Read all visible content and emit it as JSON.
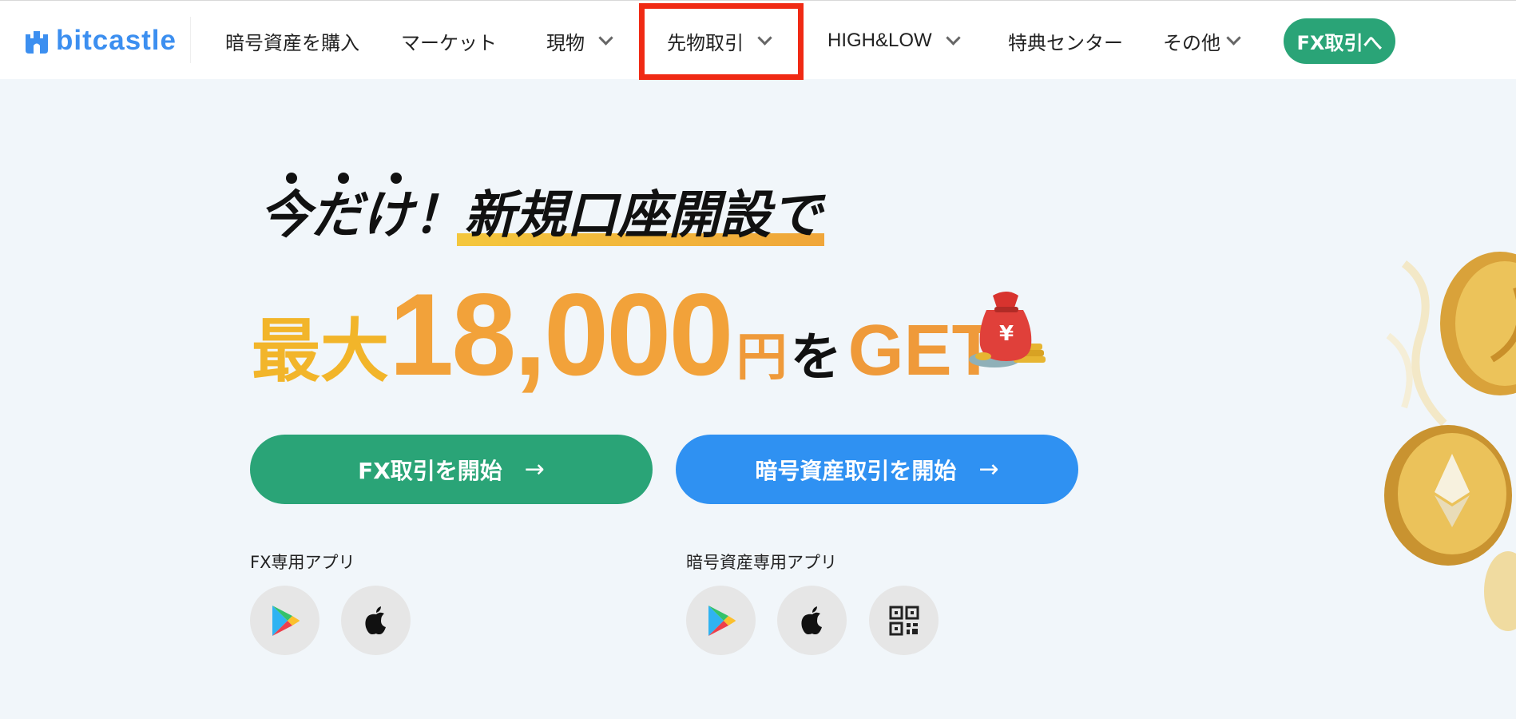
{
  "header": {
    "logo_text": "bitcastle",
    "nav": [
      {
        "label": "暗号資産を購入"
      },
      {
        "label": "マーケット"
      },
      {
        "label": "現物"
      },
      {
        "label": "先物取引"
      },
      {
        "label": "HIGH&LOW"
      },
      {
        "label": "特典センター"
      },
      {
        "label": "その他"
      }
    ],
    "cta_label": "FX取引へ"
  },
  "hero": {
    "line1_prefix": "今だけ！",
    "line1_highlight": "新規口座開設で",
    "line2_prefix": "最大",
    "line2_amount": "18,000",
    "line2_unit": "円",
    "line2_particle": "を",
    "line2_get": "GET",
    "bag_symbol": "¥"
  },
  "actions": {
    "fx_button": "FX取引を開始",
    "crypto_button": "暗号資産取引を開始",
    "arrow": "→"
  },
  "apps": {
    "fx_label": "FX専用アプリ",
    "crypto_label": "暗号資産専用アプリ",
    "icons": [
      "google-play-icon",
      "apple-icon",
      "qr-code-icon"
    ]
  },
  "colors": {
    "brand_blue": "#3c8ff0",
    "fx_green": "#2aa477",
    "crypto_blue": "#2f91f2",
    "highlight_red": "#f02a14",
    "accent_orange": "#f2a23a"
  }
}
